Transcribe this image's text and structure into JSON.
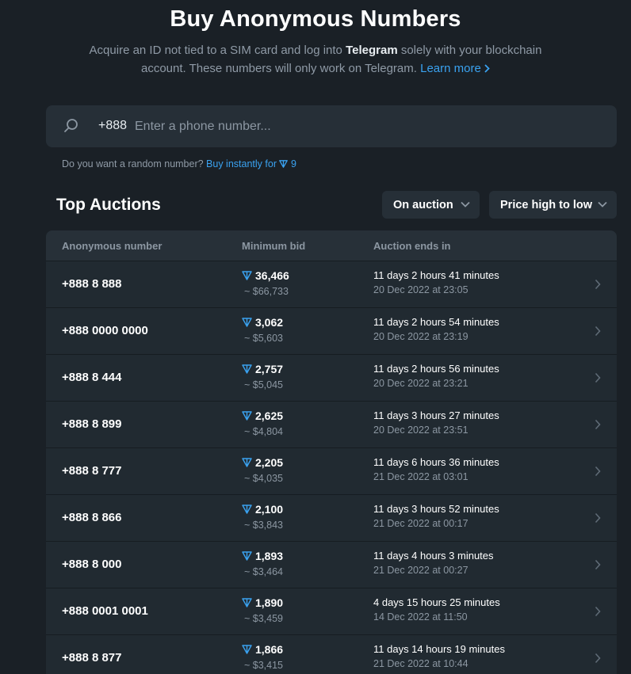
{
  "header": {
    "title": "Buy Anonymous Numbers",
    "subtitle_part1": "Acquire an ID not tied to a SIM card and log into ",
    "subtitle_bold": "Telegram",
    "subtitle_part2": " solely with your blockchain account. These numbers will only work on Telegram. ",
    "learn_more": "Learn more"
  },
  "search": {
    "prefix": "+888",
    "placeholder": "Enter a phone number..."
  },
  "random": {
    "question": "Do you want a random number? ",
    "buy_label": "Buy instantly for",
    "price": "9"
  },
  "auctions": {
    "title": "Top Auctions",
    "filter": "On auction",
    "sort": "Price high to low",
    "columns": [
      "Anonymous number",
      "Minimum bid",
      "Auction ends in"
    ],
    "rows": [
      {
        "number": "+888 8 888",
        "bid": "36,466",
        "usd": "~ $66,733",
        "ends": "11 days 2 hours 41 minutes",
        "date": "20 Dec 2022 at 23:05"
      },
      {
        "number": "+888 0000 0000",
        "bid": "3,062",
        "usd": "~ $5,603",
        "ends": "11 days 2 hours 54 minutes",
        "date": "20 Dec 2022 at 23:19"
      },
      {
        "number": "+888 8 444",
        "bid": "2,757",
        "usd": "~ $5,045",
        "ends": "11 days 2 hours 56 minutes",
        "date": "20 Dec 2022 at 23:21"
      },
      {
        "number": "+888 8 899",
        "bid": "2,625",
        "usd": "~ $4,804",
        "ends": "11 days 3 hours 27 minutes",
        "date": "20 Dec 2022 at 23:51"
      },
      {
        "number": "+888 8 777",
        "bid": "2,205",
        "usd": "~ $4,035",
        "ends": "11 days 6 hours 36 minutes",
        "date": "21 Dec 2022 at 03:01"
      },
      {
        "number": "+888 8 866",
        "bid": "2,100",
        "usd": "~ $3,843",
        "ends": "11 days 3 hours 52 minutes",
        "date": "21 Dec 2022 at 00:17"
      },
      {
        "number": "+888 8 000",
        "bid": "1,893",
        "usd": "~ $3,464",
        "ends": "11 days 4 hours 3 minutes",
        "date": "21 Dec 2022 at 00:27"
      },
      {
        "number": "+888 0001 0001",
        "bid": "1,890",
        "usd": "~ $3,459",
        "ends": "4 days 15 hours 25 minutes",
        "date": "14 Dec 2022 at 11:50"
      },
      {
        "number": "+888 8 877",
        "bid": "1,866",
        "usd": "~ $3,415",
        "ends": "11 days 14 hours 19 minutes",
        "date": "21 Dec 2022 at 10:44"
      }
    ]
  },
  "colors": {
    "background": "#1a2026",
    "accent": "#3aa2f0",
    "muted": "#8c97a2"
  },
  "icons": {
    "search": "search-icon",
    "ton": "ton-icon",
    "chevron_down": "chevron-down-icon",
    "chevron_right": "chevron-right-icon"
  }
}
